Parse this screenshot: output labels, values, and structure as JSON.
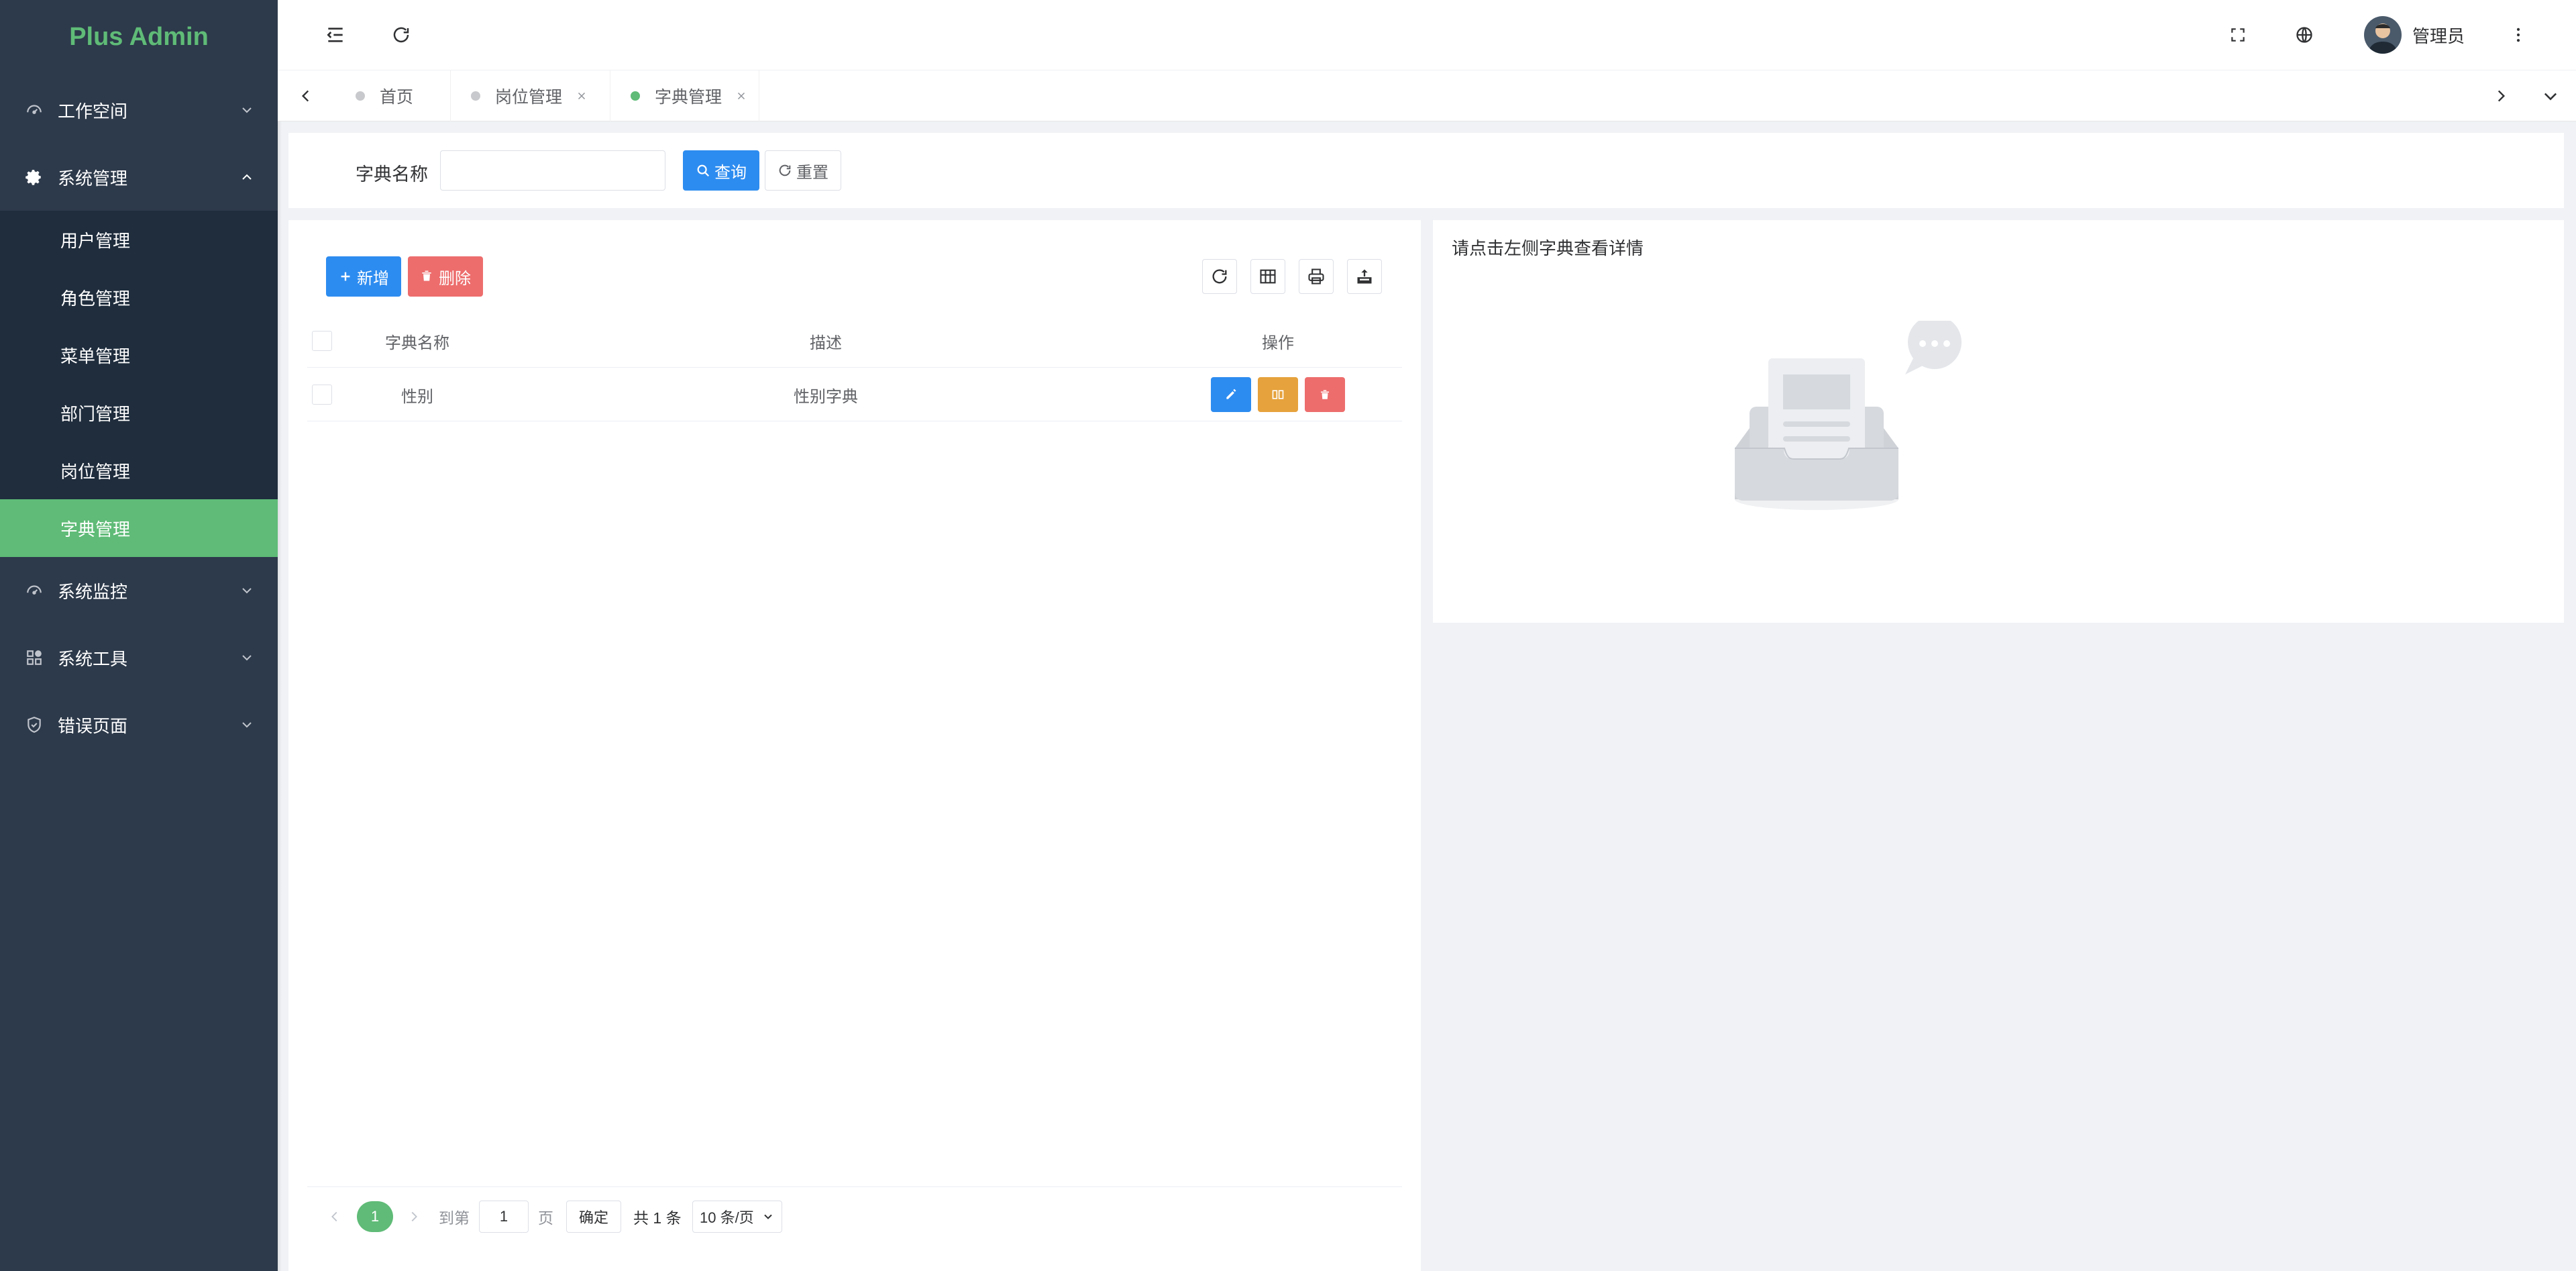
{
  "app": {
    "logo": "Plus Admin"
  },
  "sidebar": {
    "menus": [
      {
        "label": "工作空间",
        "icon": "dashboard-icon",
        "expanded": false
      },
      {
        "label": "系统管理",
        "icon": "gear-icon",
        "expanded": true,
        "children": [
          "用户管理",
          "角色管理",
          "菜单管理",
          "部门管理",
          "岗位管理",
          "字典管理"
        ],
        "active_child": "字典管理"
      },
      {
        "label": "系统监控",
        "icon": "monitor-icon",
        "expanded": false
      },
      {
        "label": "系统工具",
        "icon": "tools-icon",
        "expanded": false
      },
      {
        "label": "错误页面",
        "icon": "shield-icon",
        "expanded": false
      }
    ]
  },
  "header": {
    "username": "管理员"
  },
  "tags": [
    {
      "label": "首页",
      "closable": false,
      "active": false
    },
    {
      "label": "岗位管理",
      "closable": true,
      "active": false
    },
    {
      "label": "字典管理",
      "closable": true,
      "active": true
    }
  ],
  "search": {
    "label": "字典名称",
    "value": "",
    "query_label": "查询",
    "reset_label": "重置"
  },
  "toolbar": {
    "add_label": "新增",
    "delete_label": "删除"
  },
  "table": {
    "columns": [
      "字典名称",
      "描述",
      "操作"
    ],
    "rows": [
      {
        "name": "性别",
        "desc": "性别字典"
      }
    ]
  },
  "pagination": {
    "current_page": "1",
    "goto_prefix": "到第",
    "goto_value": "1",
    "goto_suffix": "页",
    "confirm": "确定",
    "total": "共 1 条",
    "page_size": "10 条/页"
  },
  "detail": {
    "hint": "请点击左侧字典查看详情"
  },
  "colors": {
    "accent": "#5fbb77",
    "primary": "#2d8cf0",
    "warning": "#e6a23c",
    "danger": "#ed6d6d",
    "sidebar_bg": "#2d3a4b",
    "submenu_bg": "#1f2d3d"
  }
}
